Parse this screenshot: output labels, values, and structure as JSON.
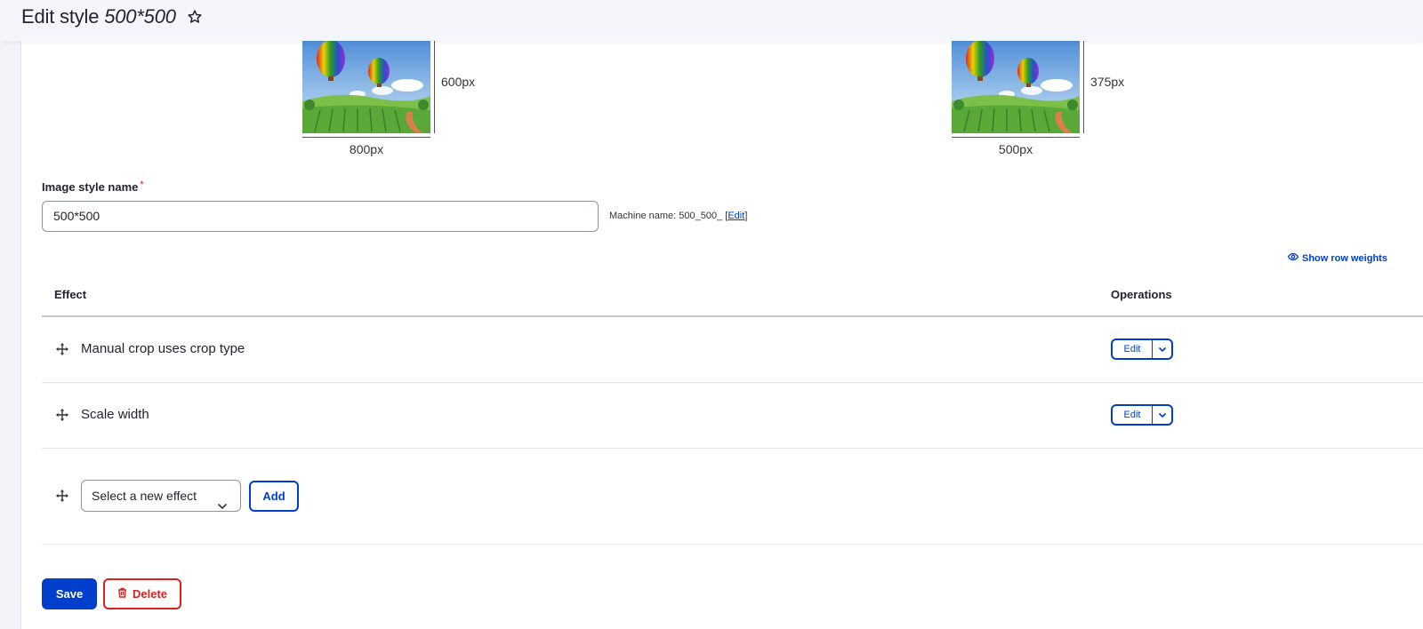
{
  "header": {
    "title_prefix": "Edit style",
    "title_name": "500*500"
  },
  "previews": [
    {
      "height_label": "600px",
      "width_label": "800px"
    },
    {
      "height_label": "375px",
      "width_label": "500px"
    }
  ],
  "form": {
    "name_label": "Image style name",
    "required_mark": "*",
    "name_value": "500*500",
    "machine_name_prefix": "Machine name: 500_500_",
    "machine_name_open": "[",
    "machine_name_edit": "Edit",
    "machine_name_close": "]"
  },
  "table": {
    "show_row_weights": "Show row weights",
    "col_effect": "Effect",
    "col_operations": "Operations",
    "rows": [
      {
        "label": "Manual crop uses crop type",
        "edit_label": "Edit"
      },
      {
        "label": "Scale width",
        "edit_label": "Edit"
      }
    ],
    "new_effect_placeholder": "Select a new effect",
    "add_label": "Add"
  },
  "actions": {
    "save_label": "Save",
    "delete_label": "Delete"
  },
  "colors": {
    "accent": "#003ecc",
    "danger": "#d72222"
  },
  "icons": [
    "star-icon",
    "eye-icon",
    "drag-handle-icon",
    "chevron-down-icon",
    "trash-icon"
  ]
}
